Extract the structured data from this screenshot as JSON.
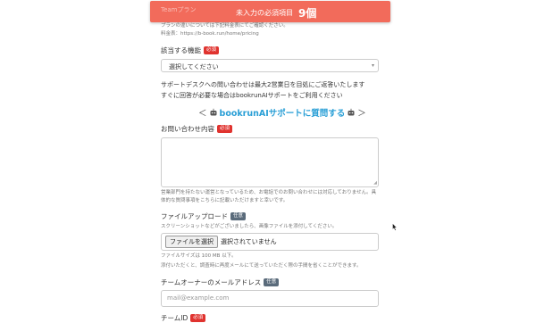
{
  "banner": {
    "behind_text": "Teamプラン",
    "message": "未入力の必須項目",
    "count": "9個"
  },
  "plan_note": {
    "line1": "プランの違いについては下記料金表にてご確認ください。",
    "line2": "料金表：https://b-book.run/home/pricing"
  },
  "applicable_feature": {
    "label": "該当する機能",
    "badge": "必須",
    "select_value": "選択してください"
  },
  "support_info": {
    "line1": "サポートデスクへの問い合わせは最大2営業日を目処にご返答いたします",
    "line2": "すぐに回答が必要な場合はbookrunAIサポートをご利用ください"
  },
  "ai_link": {
    "open": "＜",
    "text": "bookrunAIサポートに質問する",
    "close": "＞"
  },
  "inquiry": {
    "label": "お問い合わせ内容",
    "badge": "必須",
    "note1": "営業部門を持たない運営となっているため、お電話でのお問い合わせには対応しておりません。具体的な質問事項をこちらに記載いただけますと幸いです。",
    "note2": ""
  },
  "file_upload": {
    "label": "ファイルアップロード",
    "badge": "任意",
    "hint": "スクリーンショットなどがございましたら、画像ファイルを添付してください。",
    "button": "ファイルを選択",
    "status": "選択されていません",
    "size_note": "ファイルサイズは 100 MB 以下。",
    "resend_note": "添付いただくと、調査時に再度メールにて送っていただく際の手間を省くことができます。"
  },
  "owner_email": {
    "label": "チームオーナーのメールアドレス",
    "badge": "任意",
    "placeholder": "mail@example.com"
  },
  "team_id": {
    "label": "チームID",
    "badge": "必須"
  },
  "colors": {
    "banner": "#f26b5b",
    "required": "#e0332f",
    "optional": "#5a6b7b",
    "link": "#2a9fd6"
  }
}
